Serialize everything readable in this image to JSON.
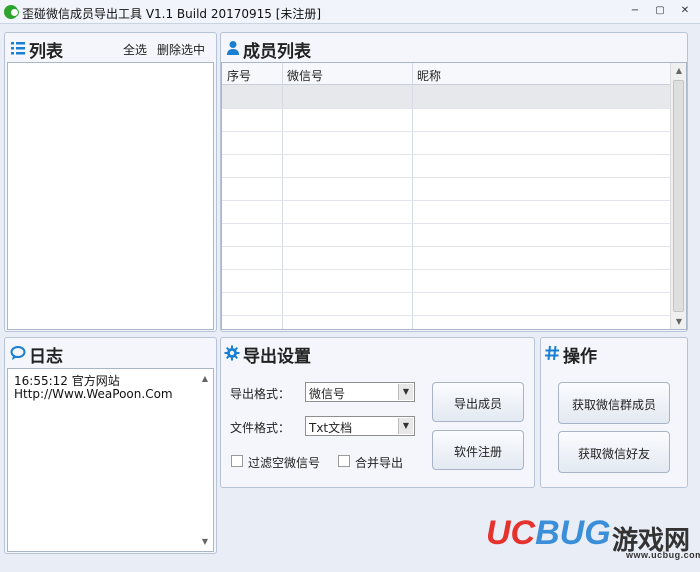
{
  "window": {
    "title": "歪碰微信成员导出工具 V1.1 Build 20170915    [未注册]",
    "minimize_glyph": "−",
    "maximize_glyph": "▢",
    "close_glyph": "✕"
  },
  "list_panel": {
    "title": "列表",
    "select_all": "全选",
    "delete_selected": "删除选中",
    "icon": "list-icon"
  },
  "member_panel": {
    "title": "成员列表",
    "icon": "person-icon",
    "columns": [
      "序号",
      "微信号",
      "昵称"
    ],
    "rows": []
  },
  "log_panel": {
    "title": "日志",
    "icon": "chat-bubble-icon",
    "lines": [
      "16:55:12    官方网站",
      "Http://Www.WeaPoon.Com"
    ]
  },
  "export_panel": {
    "title": "导出设置",
    "icon": "gear-icon",
    "export_format_label": "导出格式：",
    "export_format_value": "微信号",
    "file_format_label": "文件格式：",
    "file_format_value": "Txt文档",
    "filter_empty_label": "过滤空微信号",
    "merge_export_label": "合并导出",
    "export_button": "导出成员",
    "register_button": "软件注册"
  },
  "ops_panel": {
    "title": "操作",
    "icon": "hash-icon",
    "get_group_members": "获取微信群成员",
    "get_friends": "获取微信好友"
  },
  "watermark": {
    "uc": "UC",
    "bug": "BUG",
    "cn": "游戏网",
    "url": "www.ucbug.com"
  },
  "colors": {
    "accent": "#1a7fd0",
    "panel_bg": "#f4f6fb",
    "window_bg": "#e9eef6"
  }
}
